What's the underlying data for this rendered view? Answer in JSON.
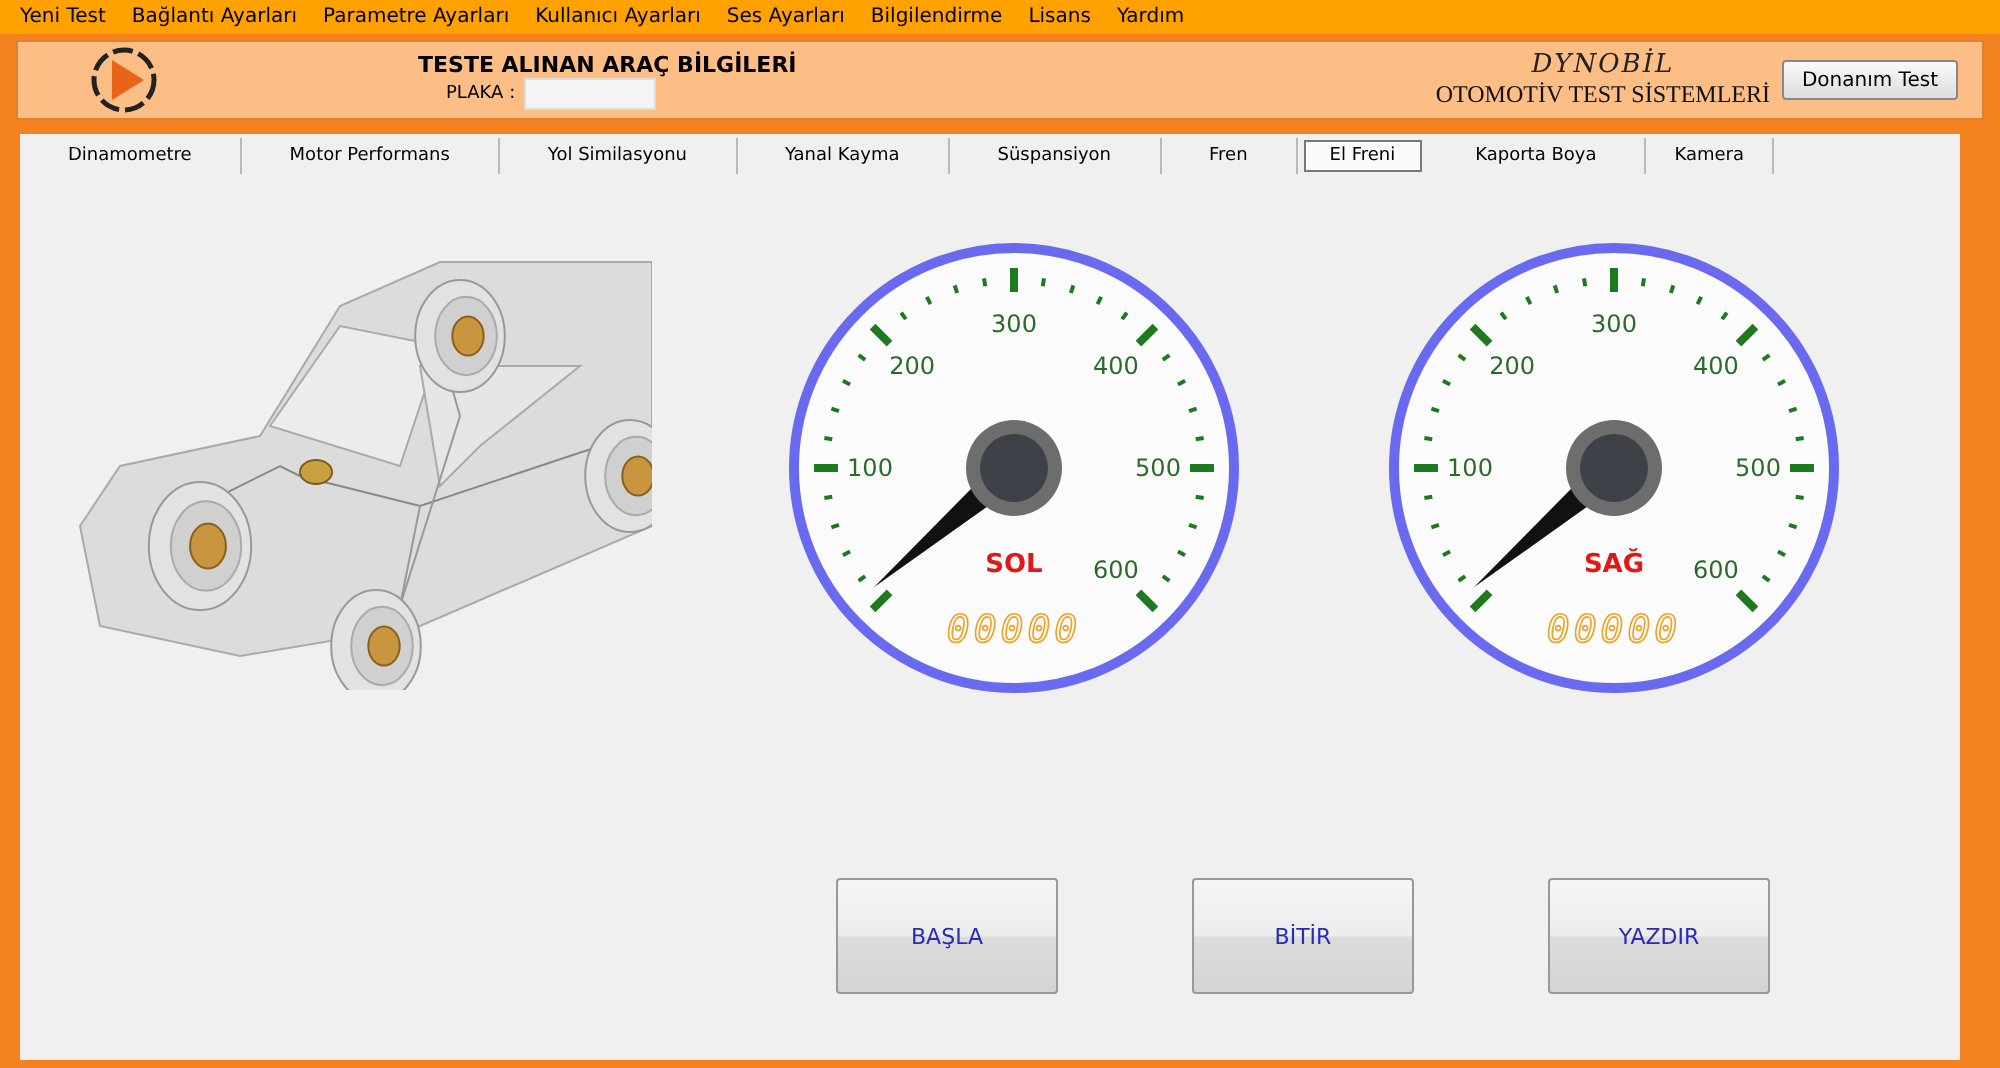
{
  "menu": [
    "Yeni Test",
    "Bağlantı Ayarları",
    "Parametre Ayarları",
    "Kullanıcı Ayarları",
    "Ses Ayarları",
    "Bilgilendirme",
    "Lisans",
    "Yardım"
  ],
  "header": {
    "title": "TESTE ALINAN ARAÇ BİLGİLERİ",
    "plate_label": "PLAKA :",
    "brand": "DYNOBİL",
    "subtitle": "OTOMOTİV TEST SİSTEMLERİ",
    "button": "Donanım Test"
  },
  "tabs": [
    {
      "label": "Dinamometre",
      "selected": false
    },
    {
      "label": "Motor Performans",
      "selected": false
    },
    {
      "label": "Yol Similasyonu",
      "selected": false
    },
    {
      "label": "Yanal Kayma",
      "selected": false
    },
    {
      "label": "Süspansiyon",
      "selected": false
    },
    {
      "label": "Fren",
      "selected": false
    },
    {
      "label": "El Freni",
      "selected": true
    },
    {
      "label": "Kaporta Boya",
      "selected": false
    },
    {
      "label": "Kamera",
      "selected": false
    }
  ],
  "gauges": [
    {
      "label": "SOL",
      "scale": [
        "100",
        "200",
        "300",
        "400",
        "500",
        "600"
      ],
      "display": "00000"
    },
    {
      "label": "SAĞ",
      "scale": [
        "100",
        "200",
        "300",
        "400",
        "500",
        "600"
      ],
      "display": "00000"
    }
  ],
  "buttons": [
    "BAŞLA",
    "BİTİR",
    "YAZDIR"
  ]
}
